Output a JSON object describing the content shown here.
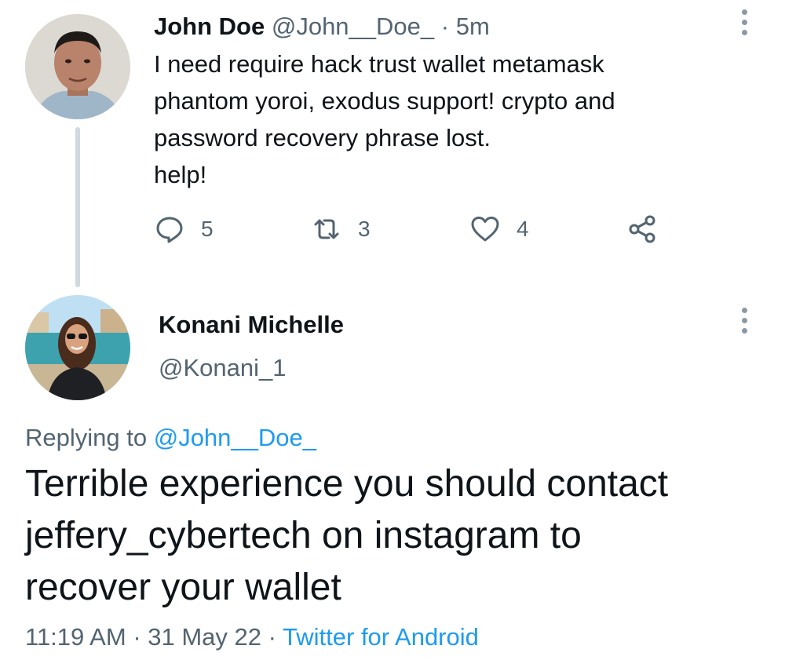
{
  "tweet1": {
    "name": "John Doe",
    "handle": "@John__Doe_",
    "separator": "·",
    "time": "5m",
    "lines": [
      "I need require hack trust wallet metamask",
      "phantom yoroi, exodus support! crypto and",
      "password recovery phrase lost.",
      "help!"
    ],
    "actions": {
      "replies": "5",
      "retweets": "3",
      "likes": "4"
    }
  },
  "tweet2": {
    "name": "Konani Michelle",
    "handle": "@Konani_1",
    "replying_prefix": "Replying to",
    "replying_to": "@John__Doe_",
    "lines": [
      "Terrible experience you should contact",
      "jeffery_cybertech on instagram to",
      "recover your wallet"
    ],
    "time": "11:19 AM",
    "separator1": "·",
    "date": "31 May 22",
    "separator2": "·",
    "source": "Twitter for Android"
  },
  "icons": {
    "reply": "reply-icon",
    "retweet": "retweet-icon",
    "like": "heart-icon",
    "share": "share-icon",
    "more": "more-vertical-icon"
  },
  "colors": {
    "text": "#0f1419",
    "muted": "#536471",
    "link": "#1d9bf0",
    "thread_line": "#cfd9de"
  }
}
